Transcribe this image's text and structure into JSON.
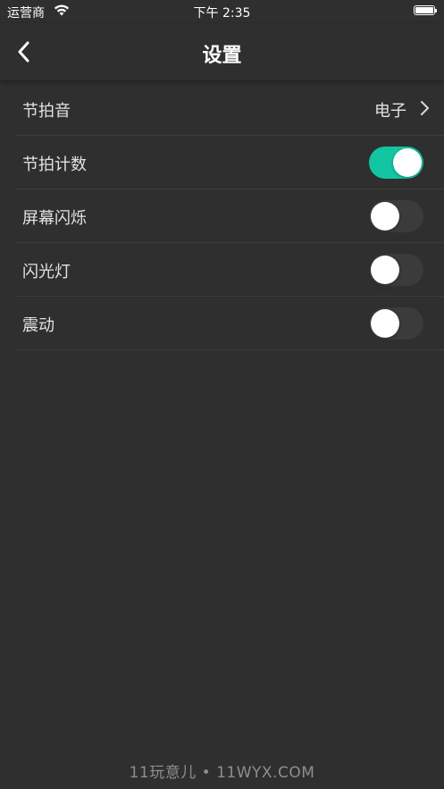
{
  "status_bar": {
    "carrier": "运营商",
    "time": "下午 2:35",
    "wifi_icon": "wifi-icon",
    "battery_icon": "battery-icon"
  },
  "nav": {
    "title": "设置",
    "back_icon": "chevron-left-icon"
  },
  "colors": {
    "background": "#2f2f2f",
    "accent": "#12c6a2",
    "toggle_off": "#3b3b3b"
  },
  "settings": {
    "beat_sound": {
      "label": "节拍音",
      "value": "电子"
    },
    "beat_count": {
      "label": "节拍计数",
      "enabled": true
    },
    "screen_flash": {
      "label": "屏幕闪烁",
      "enabled": false
    },
    "flashlight": {
      "label": "闪光灯",
      "enabled": false
    },
    "vibration": {
      "label": "震动",
      "enabled": false
    }
  },
  "watermark": "11玩意儿 • 11WYX.COM"
}
